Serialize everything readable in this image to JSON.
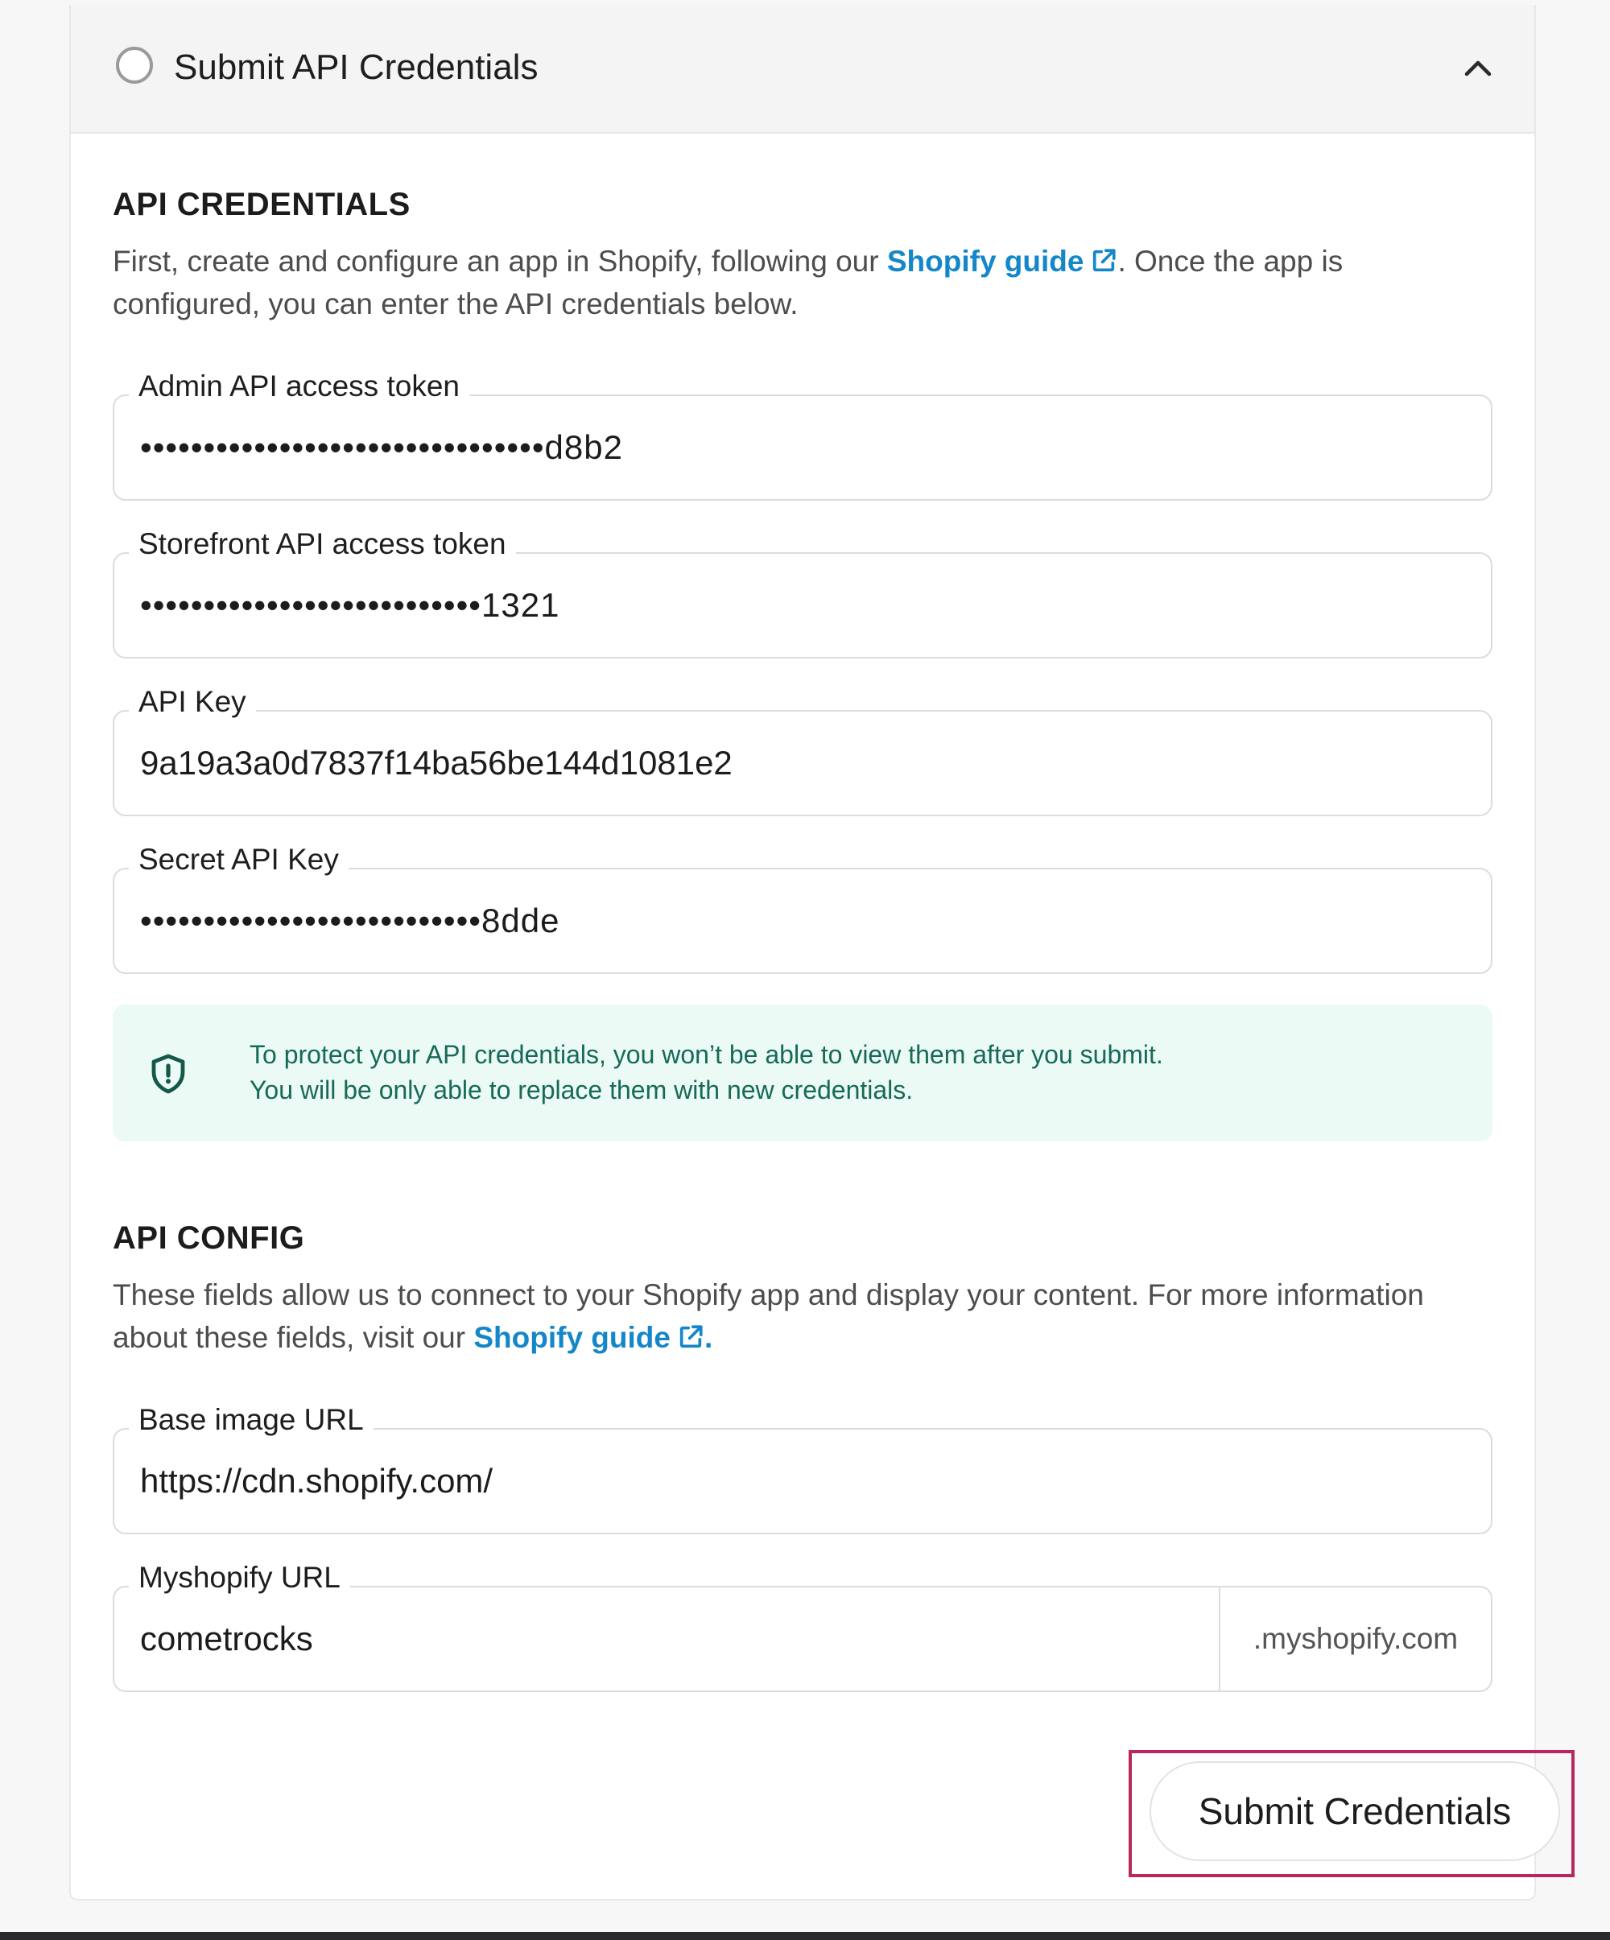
{
  "accordion": {
    "title": "Submit API Credentials"
  },
  "credentials": {
    "heading": "API CREDENTIALS",
    "desc_before_link": "First, create and configure an app in Shopify, following our ",
    "link_text": "Shopify guide",
    "desc_after_link": ". Once the app is configured, you can enter the API credentials below.",
    "fields": [
      {
        "label": "Admin API access token",
        "value": "••••••••••••••••••••••••••••••••d8b2"
      },
      {
        "label": "Storefront API access token",
        "value": "•••••••••••••••••••••••••••1321"
      },
      {
        "label": "API Key",
        "value": "9a19a3a0d7837f14ba56be144d1081e2"
      },
      {
        "label": "Secret API Key",
        "value": "•••••••••••••••••••••••••••8dde"
      }
    ],
    "notice_line1": "To protect your API credentials, you won’t be able to view them after you submit.",
    "notice_line2": "You will be only able to replace them with new credentials."
  },
  "config": {
    "heading": "API CONFIG",
    "desc_before_link": "These fields allow us to connect to your Shopify app and display your content. For more information about these fields, visit our ",
    "link_text": "Shopify guide",
    "desc_after_link": ".",
    "base_image": {
      "label": "Base image URL",
      "value": "https://cdn.shopify.com/"
    },
    "myshopify": {
      "label": "Myshopify URL",
      "value": "cometrocks",
      "suffix": ".myshopify.com"
    }
  },
  "submit_label": "Submit Credentials",
  "colors": {
    "link": "#1487c8",
    "notice_bg": "#ebfaf5",
    "notice_text": "#166a56",
    "highlight": "#b8285f"
  },
  "icons": [
    "radio-circle-icon",
    "chevron-up-icon",
    "external-link-icon",
    "shield-icon"
  ]
}
